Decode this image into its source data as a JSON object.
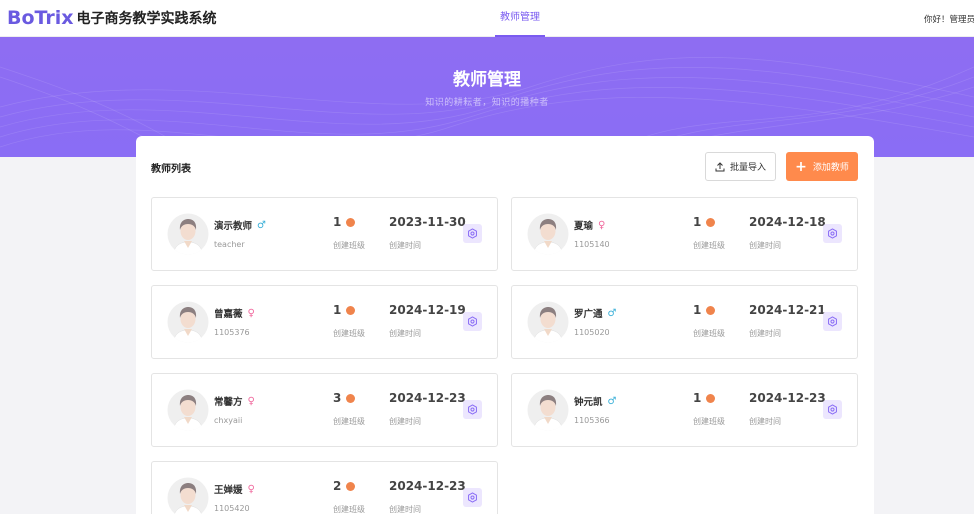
{
  "header": {
    "logo_mark": "BoTrix",
    "app_title": "电子商务教学实践系统",
    "nav_active": "教师管理",
    "greeting": "你好！管理员小"
  },
  "hero": {
    "title": "教师管理",
    "subtitle": "知识的耕耘者，知识的播种者"
  },
  "panel": {
    "title": "教师列表",
    "import_label": "批量导入",
    "add_label": "添加教师"
  },
  "labels": {
    "class_count": "创建班级",
    "created_time": "创建时间"
  },
  "teachers": [
    {
      "name": "演示教师",
      "gender": "male",
      "id": "teacher",
      "classes": "1",
      "date": "2023-11-30"
    },
    {
      "name": "夏瑜",
      "gender": "female",
      "id": "1105140",
      "classes": "1",
      "date": "2024-12-18"
    },
    {
      "name": "曾嘉薇",
      "gender": "female",
      "id": "1105376",
      "classes": "1",
      "date": "2024-12-19"
    },
    {
      "name": "罗广通",
      "gender": "male",
      "id": "1105020",
      "classes": "1",
      "date": "2024-12-21"
    },
    {
      "name": "常馨方",
      "gender": "female",
      "id": "chxyaii",
      "classes": "3",
      "date": "2024-12-23"
    },
    {
      "name": "钟元凯",
      "gender": "male",
      "id": "1105366",
      "classes": "1",
      "date": "2024-12-23"
    },
    {
      "name": "王婵媛",
      "gender": "female",
      "id": "1105420",
      "classes": "2",
      "date": "2024-12-23"
    }
  ],
  "icons": {
    "male": "♂",
    "female": "♀"
  },
  "colors": {
    "accent": "#7a5bf0",
    "hero": "#8e6df2",
    "add_button": "#ff8a4c",
    "dot": "#f0844c"
  }
}
